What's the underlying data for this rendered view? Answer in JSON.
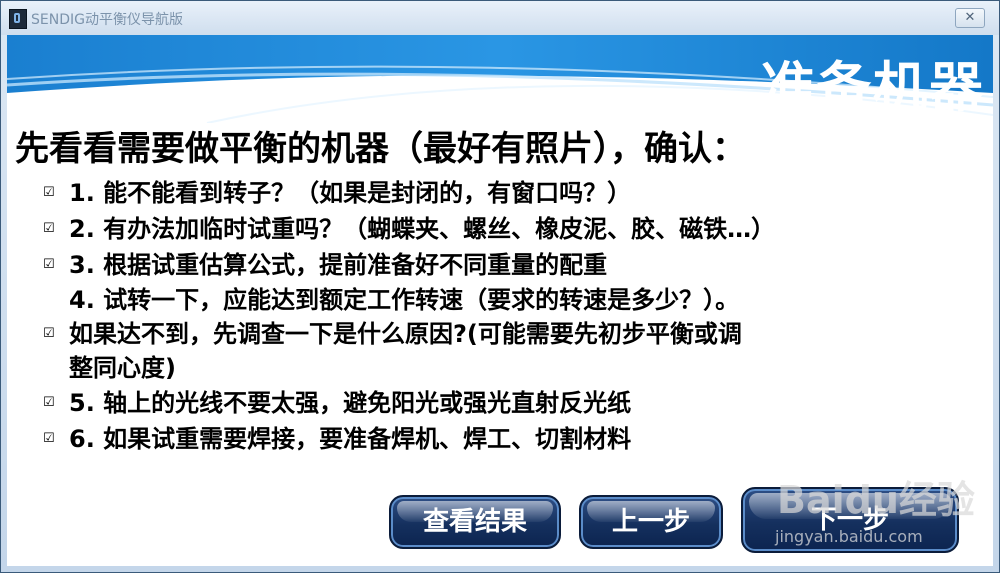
{
  "window": {
    "title": "SENDIG动平衡仪导航版",
    "close_label": "✕"
  },
  "header": {
    "title": "准备机器"
  },
  "subtitle": "先看看需要做平衡的机器（最好有照片），确认：",
  "checklist": [
    {
      "text": "1. 能不能看到转子？（如果是封闭的，有窗口吗？）",
      "checked": true
    },
    {
      "text": "2. 有办法加临时试重吗？（蝴蝶夹、螺丝、橡皮泥、胶、磁铁…）",
      "checked": true
    },
    {
      "text": "3. 根据试重估算公式，提前准备好不同重量的配重",
      "checked": true
    },
    {
      "line1": "4. 试转一下，应能达到额定工作转速（要求的转速是多少？）。",
      "line2": "如果达不到，先调查一下是什么原因?(可能需要先初步平衡或调",
      "line3": "整同心度)",
      "checked": true
    },
    {
      "text": "5. 轴上的光线不要太强，避免阳光或强光直射反光纸",
      "checked": true
    },
    {
      "text": "6. 如果试重需要焊接，要准备焊机、焊工、切割材料",
      "checked": true
    }
  ],
  "buttons": {
    "view_results": "查看结果",
    "previous": "上一步",
    "next": "下一步"
  },
  "watermark": {
    "brand": "Baidu经验",
    "url": "jingyan.baidu.com"
  },
  "colors": {
    "header_blue": "#1f86d6",
    "button_navy": "#15305e",
    "text": "#000000"
  }
}
